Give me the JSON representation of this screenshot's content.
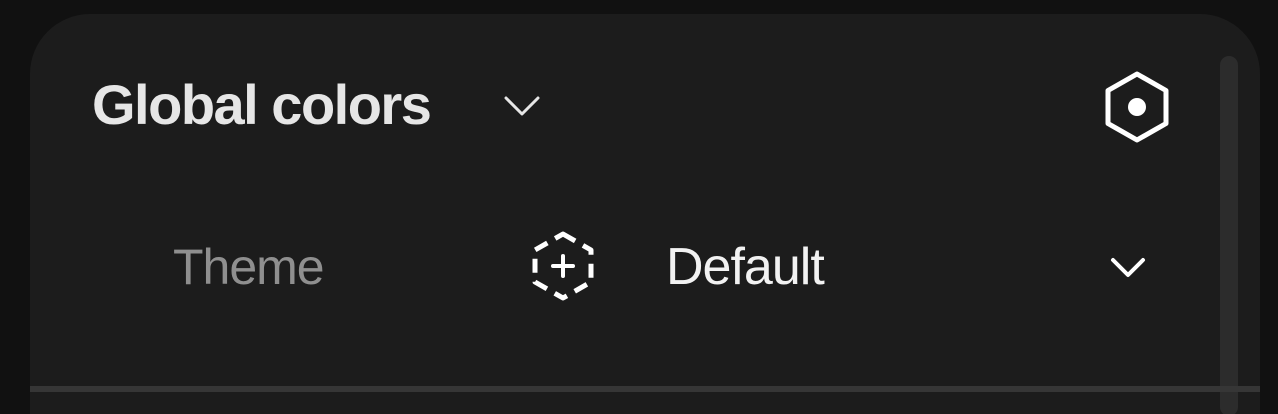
{
  "section": {
    "title": "Global colors",
    "collapse_icon": "chevron-down-icon",
    "settings_icon": "hexagon-dot-icon"
  },
  "theme_row": {
    "label": "Theme",
    "variable_icon": "dashed-hexagon-plus-icon",
    "value": "Default",
    "dropdown_icon": "chevron-down-icon"
  },
  "colors": {
    "page_background": "#111111",
    "panel_background": "#1c1c1c",
    "title_text": "#e6e6e6",
    "label_text": "#8f8f8f",
    "value_text": "#f2f2f2",
    "icon": "#ffffff",
    "divider": "#363636",
    "scrollbar": "#2c2c2c"
  }
}
